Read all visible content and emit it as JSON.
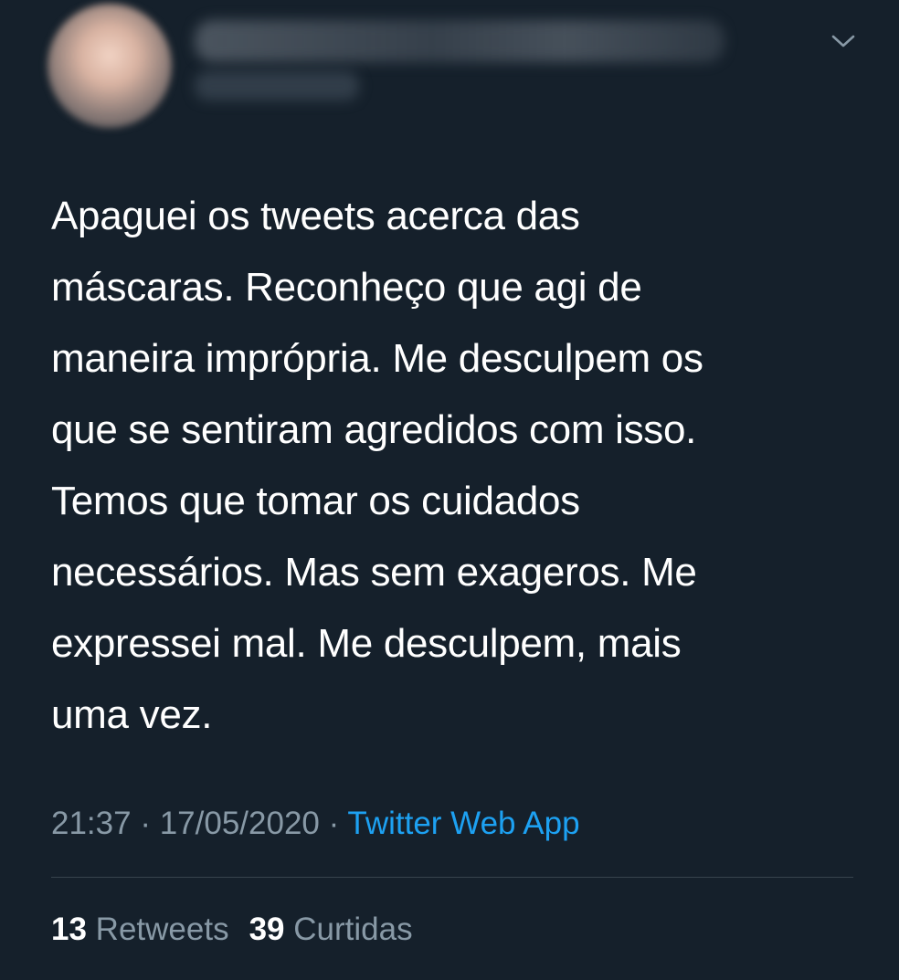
{
  "tweet": {
    "author": {
      "name": "",
      "handle": "",
      "avatar_blurred": true
    },
    "menu_icon": "chevron-down-icon",
    "text": "Apaguei os tweets acerca das\nmáscaras. Reconheço que agi de\nmaneira imprópria. Me desculpem os\nque se sentiram agredidos com isso.\nTemos que tomar os cuidados\nnecessários. Mas sem exageros. Me\nexpressei mal. Me desculpem, mais\numa vez.",
    "time": "21:37",
    "separator": "·",
    "date": "17/05/2020",
    "source": "Twitter Web App",
    "retweets_count": "13",
    "retweets_label": "Retweets",
    "likes_count": "39",
    "likes_label": "Curtidas"
  },
  "colors": {
    "background": "#15202b",
    "text": "#ffffff",
    "secondary_text": "#8899a6",
    "link": "#1da1f2",
    "divider": "#38444d"
  }
}
